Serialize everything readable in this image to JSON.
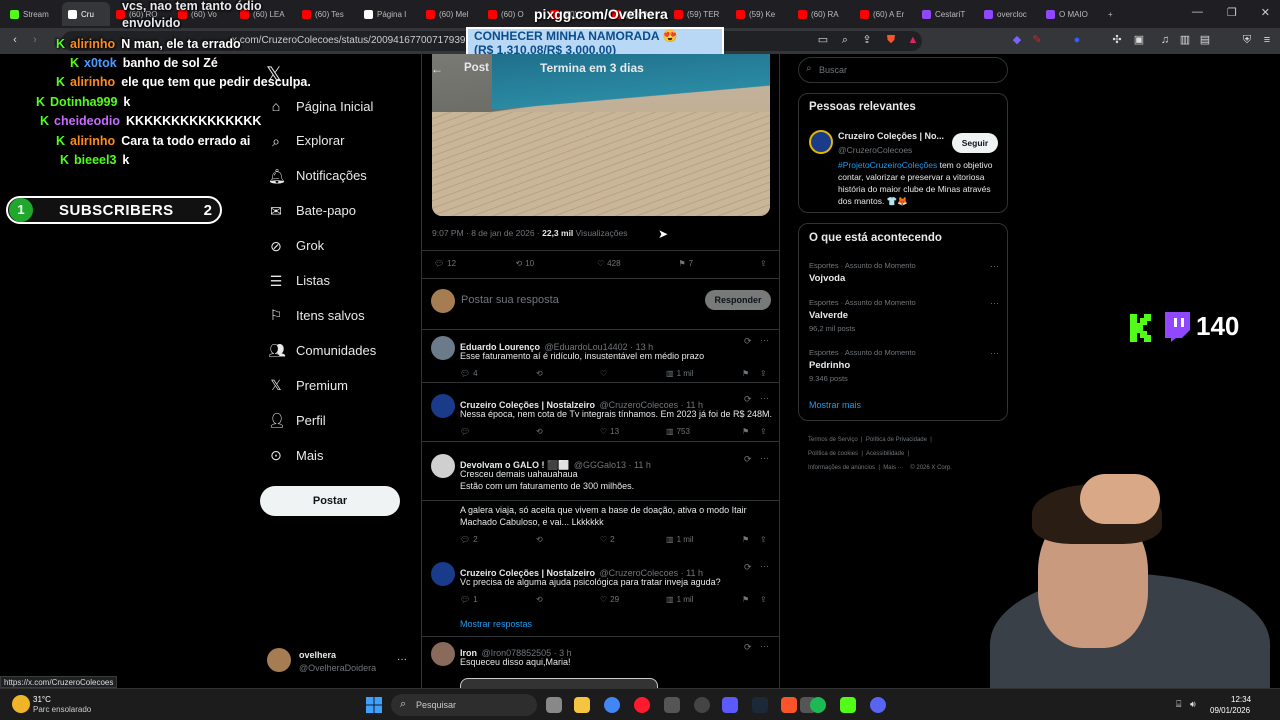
{
  "browser": {
    "tabs": [
      {
        "label": "Stream",
        "color": "#53fc18"
      },
      {
        "label": "Cru",
        "color": "#ffffff",
        "active": true
      },
      {
        "label": "(60) RO",
        "color": "#ff0000"
      },
      {
        "label": "(60) Vo",
        "color": "#ff0000"
      },
      {
        "label": "(60) LEA",
        "color": "#ff0000"
      },
      {
        "label": "(60) Tes",
        "color": "#ff0000"
      },
      {
        "label": "Página I",
        "color": "#ffffff"
      },
      {
        "label": "(60) Mel",
        "color": "#ff0000"
      },
      {
        "label": "(60) O",
        "color": "#ff0000"
      },
      {
        "label": "(60) O",
        "color": "#ff0000"
      },
      {
        "label": "(60) Qu",
        "color": "#ff0000"
      },
      {
        "label": "(59) TER",
        "color": "#ff0000"
      },
      {
        "label": "(59) Ke",
        "color": "#ff0000"
      },
      {
        "label": "(60) RA",
        "color": "#ff0000"
      },
      {
        "label": "(60) A Er",
        "color": "#ff0000"
      },
      {
        "label": "CestariT",
        "color": "#9146ff"
      },
      {
        "label": "overcloc",
        "color": "#9146ff"
      },
      {
        "label": "O MAIO",
        "color": "#9146ff"
      }
    ],
    "url": "x.com/CruzeroColecoes/status/2009416770071793978",
    "status_url": "https://x.com/CruzeroColecoes"
  },
  "overlay": {
    "pix_label": "pixgg.com/Ovelhera",
    "donate_line1": "CONHECER MINHA NAMORADA 😍",
    "donate_line2": "(R$ 1.310,08/R$ 3.000,00)",
    "chat_top1": "vcs, nao tem tanto ódio",
    "chat_top2": "envolvido",
    "chat": [
      {
        "user": "alirinho",
        "color": "#ff8c1a",
        "msg": "N man, ele ta errado"
      },
      {
        "user": "x0tok",
        "color": "#4a9cff",
        "msg": "banho de sol Zé"
      },
      {
        "user": "alirinho",
        "color": "#ff8c1a",
        "msg": "ele que tem que pedir desculpa."
      },
      {
        "user": "Dotinha999",
        "color": "#53fc18",
        "msg": "k"
      },
      {
        "user": "cheideodio",
        "color": "#c76bff",
        "msg": "KKKKKKKKKKKKKKK"
      },
      {
        "user": "alirinho",
        "color": "#ff8c1a",
        "msg": "Cara ta todo errado ai"
      },
      {
        "user": "bieeel3",
        "color": "#53fc18",
        "msg": "k"
      }
    ],
    "subs_left": "1",
    "subs_label": "SUBSCRIBERS",
    "subs_right": "2",
    "viewer_count": "140"
  },
  "nav": {
    "items": [
      "Página Inicial",
      "Explorar",
      "Notificações",
      "Bate-papo",
      "Grok",
      "Listas",
      "Itens salvos",
      "Comunidades",
      "Premium",
      "Perfil",
      "Mais"
    ],
    "post_button": "Postar",
    "account_name": "ovelhera",
    "account_handle": "@OvelheraDoidera"
  },
  "post": {
    "header_title": "Post",
    "header_sub": "Termina em 3 dias",
    "meta_time": "9:07 PM · 8 de jan de 2026 · ",
    "meta_views": "22,3 mil",
    "meta_views_label": " Visualizações",
    "replies": "12",
    "reposts": "10",
    "likes": "428",
    "bookmarks": "7",
    "reply_placeholder": "Postar sua resposta",
    "reply_button": "Responder"
  },
  "replies": [
    {
      "name": "Eduardo Lourenço",
      "handle": "@EduardoLou14402 · 13 h",
      "text": "Esse faturamento aí é ridículo, insustentável em médio prazo",
      "r": "4",
      "rt": "",
      "l": "",
      "v": "1 mil"
    },
    {
      "name": "Cruzeiro Coleções | Nostalzeiro",
      "handle": "@CruzeroColecoes · 11 h",
      "text": "Nessa época, nem cota de Tv integrais tínhamos. Em 2023 já foi de R$ 248M.",
      "r": "",
      "rt": "",
      "l": "13",
      "v": "753"
    },
    {
      "name": "Devolvam o GALO ! ⬛⬜",
      "handle": "@GGGalo13 · 11 h",
      "text": "Cresceu demais uahauahaua",
      "text2": "Estão com um faturamento de 300 milhões.",
      "text3": "A galera viaja, só aceita que vivem a base de doação, ativa o modo Itair",
      "text4": "Machado Cabuloso, e vai... Lkkkkkk",
      "r": "2",
      "rt": "",
      "l": "2",
      "v": "1 mil"
    },
    {
      "name": "Cruzeiro Coleções | Nostalzeiro",
      "handle": "@CruzeroColecoes · 11 h",
      "text": "Vc precisa de alguma ajuda psicológica para tratar inveja aguda?",
      "r": "1",
      "rt": "",
      "l": "29",
      "v": "1 mil"
    },
    {
      "name": "Iron",
      "handle": "@Iron078852505 · 3 h",
      "text": "Esqueceu disso aqui,Maria!"
    }
  ],
  "show_replies": "Mostrar respostas",
  "right": {
    "search_placeholder": "Buscar",
    "relevant_title": "Pessoas relevantes",
    "rel_name": "Cruzeiro Coleções | No...",
    "rel_handle": "@CruzeroColecoes",
    "follow": "Seguir",
    "bio_tag": "#ProjetoCruzeiroColeções",
    "bio_rest": " tem o objetivo contar, valorizar e preservar a vitoriosa história do maior clube de Minas através dos mantos. 👕🦊",
    "happening_title": "O que está acontecendo",
    "trends": [
      {
        "cat": "Esportes · Assunto do Momento",
        "title": "Vojvoda",
        "count": ""
      },
      {
        "cat": "Esportes · Assunto do Momento",
        "title": "Valverde",
        "count": "96,2 mil posts"
      },
      {
        "cat": "Esportes · Assunto do Momento",
        "title": "Pedrinho",
        "count": "9.346 posts"
      }
    ],
    "show_more": "Mostrar mais",
    "footer1": "Termos de Serviço",
    "footer2": "Política de Privacidade",
    "footer3": "Política de cookies",
    "footer4": "Acessibilidade",
    "footer5": "Informações de anúncios",
    "footer6": "Mais ···",
    "footer7": "© 2026 X Corp."
  },
  "taskbar": {
    "temp": "31°C",
    "weather": "Parc ensolarado",
    "search": "Pesquisar",
    "time": "12:34",
    "date": "09/01/2026"
  }
}
